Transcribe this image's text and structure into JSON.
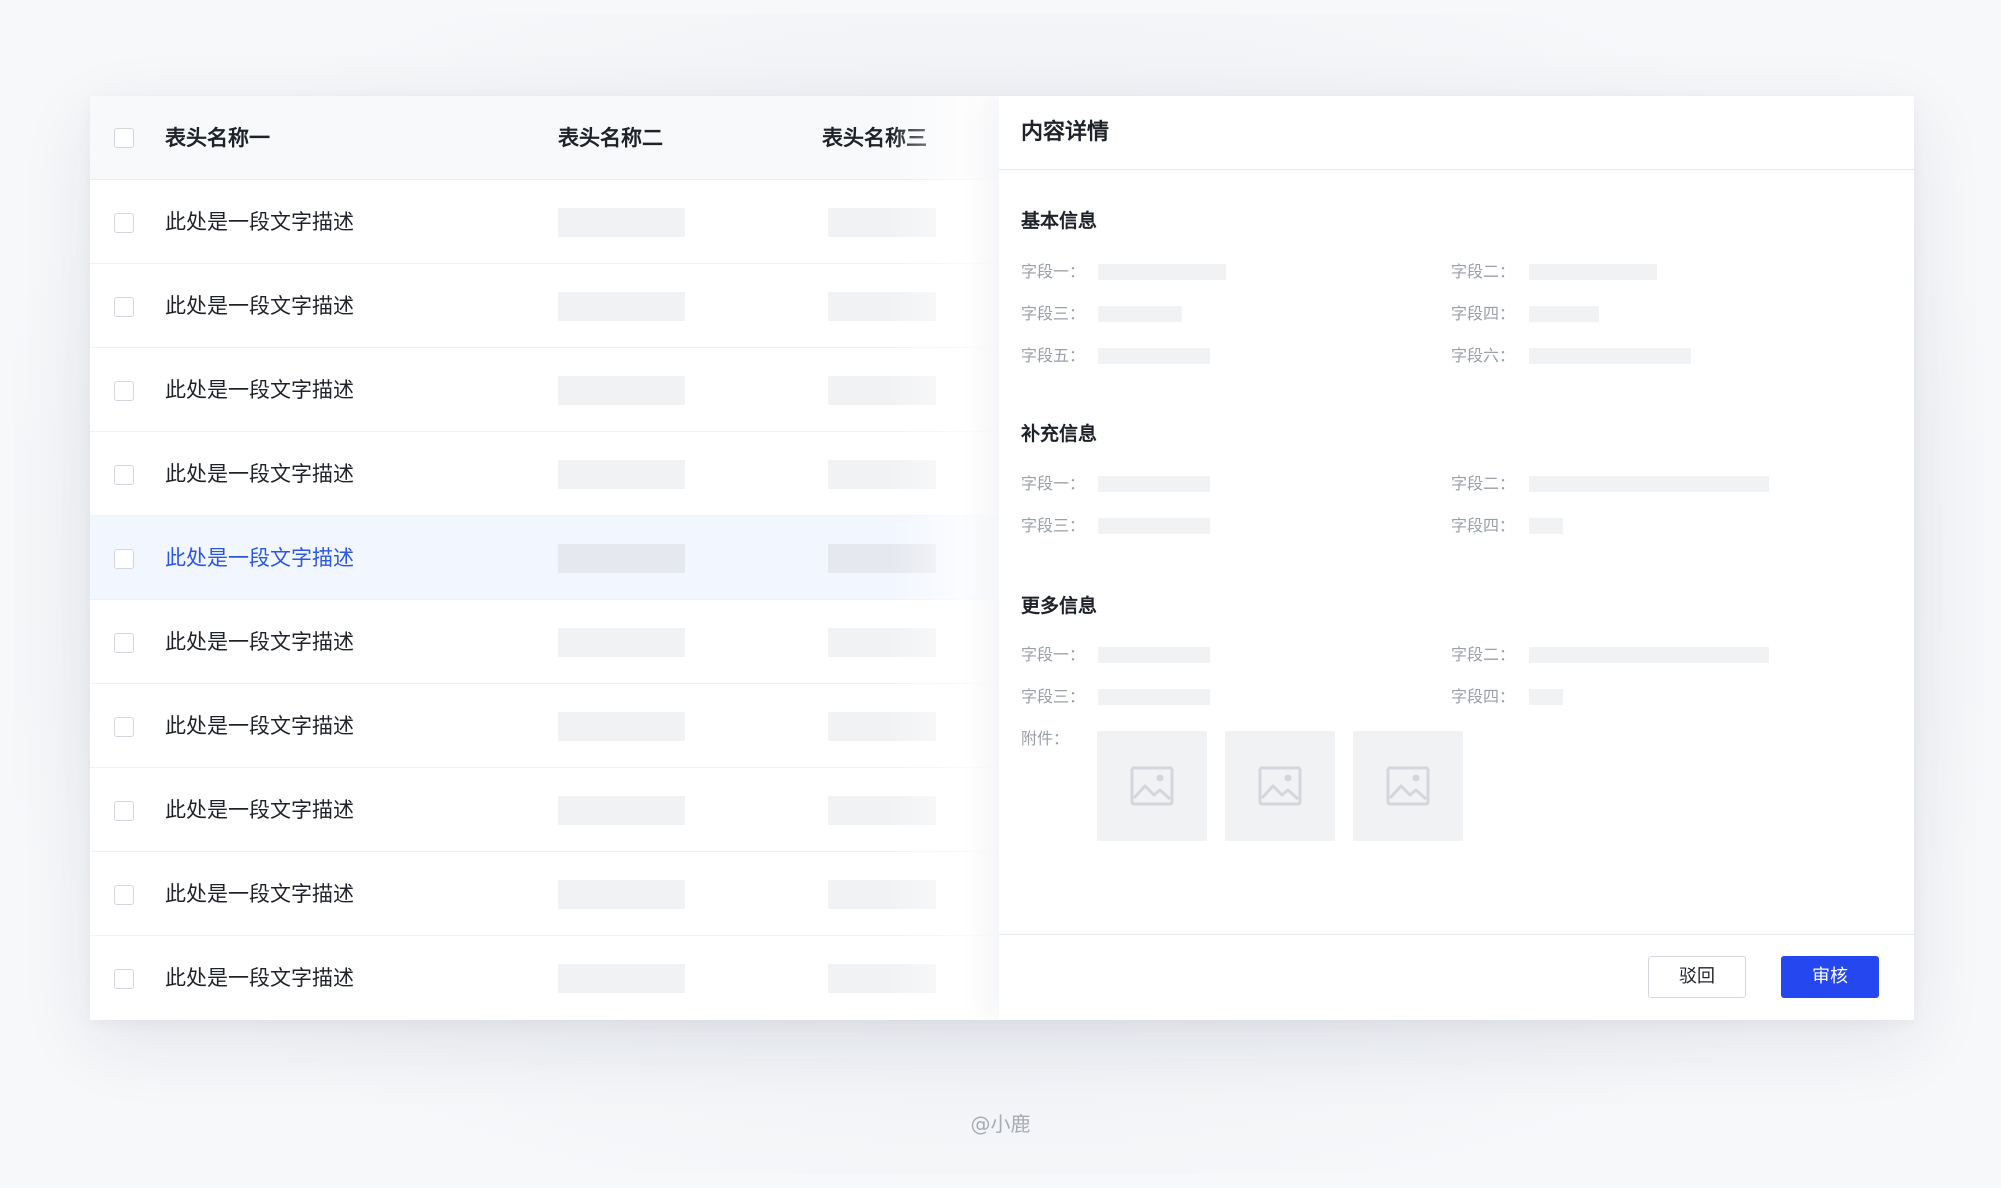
{
  "table": {
    "headers": [
      "表头名称一",
      "表头名称二",
      "表头名称三"
    ],
    "rows": [
      {
        "text": "此处是一段文字描述"
      },
      {
        "text": "此处是一段文字描述"
      },
      {
        "text": "此处是一段文字描述"
      },
      {
        "text": "此处是一段文字描述"
      },
      {
        "text": "此处是一段文字描述",
        "selected": true
      },
      {
        "text": "此处是一段文字描述"
      },
      {
        "text": "此处是一段文字描述"
      },
      {
        "text": "此处是一段文字描述"
      },
      {
        "text": "此处是一段文字描述"
      },
      {
        "text": "此处是一段文字描述"
      }
    ]
  },
  "drawer": {
    "title": "内容详情",
    "basic": {
      "title": "基本信息",
      "fields": [
        "字段一：",
        "字段二：",
        "字段三：",
        "字段四：",
        "字段五：",
        "字段六："
      ]
    },
    "extra": {
      "title": "补充信息",
      "fields": [
        "字段一：",
        "字段二：",
        "字段三：",
        "字段四："
      ]
    },
    "more": {
      "title": "更多信息",
      "fields": [
        "字段一：",
        "字段二：",
        "字段三：",
        "字段四："
      ],
      "attachment_label": "附件："
    },
    "footer": {
      "reject_label": "驳回",
      "approve_label": "审核"
    }
  },
  "watermark": "@小鹿",
  "colors": {
    "accent": "#2447ef",
    "selected_text": "#2b57e6",
    "selected_row_bg": "#f2f6ff"
  }
}
